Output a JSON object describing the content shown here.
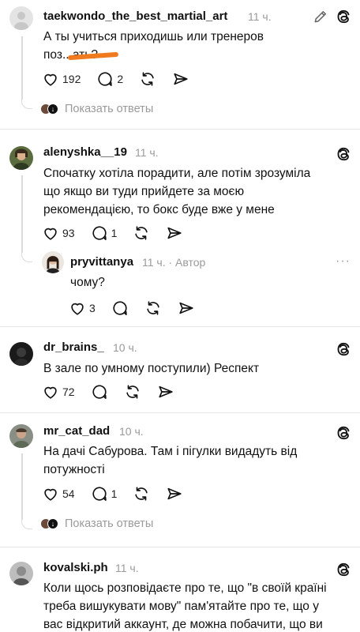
{
  "threads": [
    {
      "username": "taekwondo_the_best_martial_art",
      "time": "11 ч.",
      "lines": [
        "А ты учиться приходишь или тренеров",
        "поз...ать?"
      ],
      "likes": "192",
      "replies": "2",
      "show_replies": "Показать ответы"
    },
    {
      "username": "alenyshka__19",
      "time": "11 ч.",
      "lines": [
        "Спочатку хотіла порадити, але потім зрозуміла",
        "що якщо ви туди прийдете за моєю",
        "рекомендацією, то бокс буде вже у мене"
      ],
      "likes": "93",
      "replies": "1",
      "reply": {
        "username": "pryvittanya",
        "time": "11 ч.",
        "author_label": "· Автор",
        "text": "чому?",
        "likes": "3"
      }
    },
    {
      "username": "dr_brains_",
      "time": "10 ч.",
      "lines": [
        "В зале по умному поступили) Респект"
      ],
      "likes": "72"
    },
    {
      "username": "mr_cat_dad",
      "time": "10 ч.",
      "lines": [
        "На дачі Сабурова. Там і пігулки видадуть від",
        "потужності"
      ],
      "likes": "54",
      "replies": "1",
      "show_replies": "Показать ответы"
    },
    {
      "username": "kovalski.ph",
      "time": "11 ч.",
      "lines": [
        "Коли щось розповідаєте про те, що \"в своїй країні",
        "треба вишукувати мову\" пам'ятайте про те, що у",
        "вас відкритий аккаунт, де можна побачити, що ви"
      ]
    }
  ],
  "icons": {
    "like": "heart-icon",
    "reply": "comment-icon",
    "repost": "repost-icon",
    "share": "share-icon",
    "threads": "threads-logo-icon",
    "edit": "pencil-icon",
    "more": "more-dots-icon"
  },
  "colors": {
    "censor": "#f07a1e",
    "muted": "#9a9a9a"
  }
}
